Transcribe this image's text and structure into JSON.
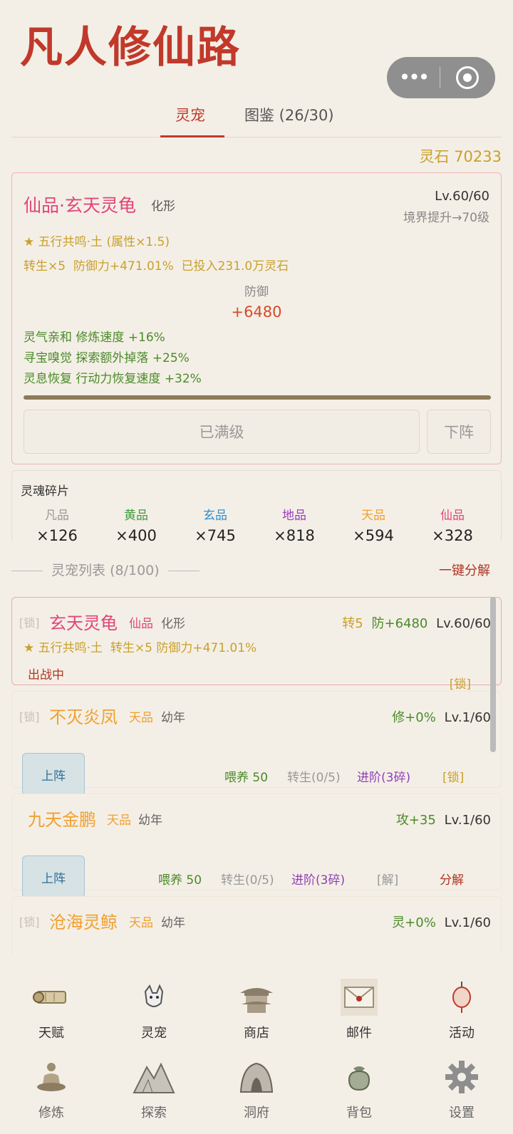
{
  "app": {
    "title": "凡人修仙路"
  },
  "capsule": {
    "more_glyph": "•••"
  },
  "tabs": [
    {
      "label": "灵宠"
    },
    {
      "label": "图鉴 (26/30)"
    }
  ],
  "stones": {
    "label": "灵石 70233"
  },
  "current_pet": {
    "name": "仙品·玄天灵龟",
    "form": "化形",
    "level": "Lv.60/60",
    "realm": "境界提升→70级",
    "resonance": "★ 五行共鸣·土 (属性×1.5)",
    "stats": "转生×5  防御力+471.01%  已投入231.0万灵石",
    "def_label": "防御",
    "def_value": "+6480",
    "buffs": [
      "灵气亲和 修炼速度 +16%",
      "寻宝嗅觉 探索额外掉落 +25%",
      "灵息恢复 行动力恢复速度 +32%"
    ],
    "progress": 1.0,
    "maxed_label": "已满级",
    "unequip_label": "下阵"
  },
  "fragments": {
    "title": "灵魂碎片",
    "items": [
      {
        "grade": "凡品",
        "count": "×126",
        "color": "#999999"
      },
      {
        "grade": "黄品",
        "count": "×400",
        "color": "#3c9a3c"
      },
      {
        "grade": "玄品",
        "count": "×745",
        "color": "#2f8fd6"
      },
      {
        "grade": "地品",
        "count": "×818",
        "color": "#9b3bc4"
      },
      {
        "grade": "天品",
        "count": "×594",
        "color": "#f0a030"
      },
      {
        "grade": "仙品",
        "count": "×328",
        "color": "#e2457a"
      }
    ]
  },
  "list": {
    "header": "灵宠列表 (8/100)",
    "decompose_all": "一键分解",
    "pets": [
      {
        "lock": "[锁]",
        "name": "玄天灵龟",
        "grade": "仙品",
        "age": "化形",
        "rebirth": "转5",
        "stat": "防+6480",
        "level": "Lv.60/60",
        "sub": "★ 五行共鸣·土  转生×5 防御力+471.01%",
        "status": "出战中",
        "lock_right": "[锁]"
      },
      {
        "lock": "[锁]",
        "name": "不灭炎凤",
        "grade": "天品",
        "age": "幼年",
        "stat": "修+0%",
        "level": "Lv.1/60",
        "up": "上阵",
        "feed": "喂养 50",
        "rebirth_act": "转生(0/5)",
        "advance": "进阶(3碎)",
        "lock_right": "[锁]"
      },
      {
        "name": "九天金鹏",
        "grade": "天品",
        "age": "幼年",
        "stat": "攻+35",
        "level": "Lv.1/60",
        "up": "上阵",
        "feed": "喂养 50",
        "rebirth_act": "转生(0/5)",
        "advance": "进阶(3碎)",
        "unlock": "[解]",
        "decompose": "分解"
      },
      {
        "lock": "[锁]",
        "name": "沧海灵鲸",
        "grade": "天品",
        "age": "幼年",
        "stat": "灵+0%",
        "level": "Lv.1/60"
      }
    ]
  },
  "nav": {
    "row1": [
      {
        "label": "天赋",
        "icon": "scroll-icon"
      },
      {
        "label": "灵宠",
        "icon": "fox-icon"
      },
      {
        "label": "商店",
        "icon": "pavilion-icon"
      },
      {
        "label": "邮件",
        "icon": "envelope-icon"
      },
      {
        "label": "活动",
        "icon": "lantern-icon"
      }
    ],
    "row2": [
      {
        "label": "修炼",
        "icon": "meditation-icon"
      },
      {
        "label": "探索",
        "icon": "mountain-icon"
      },
      {
        "label": "洞府",
        "icon": "cave-icon"
      },
      {
        "label": "背包",
        "icon": "bag-icon"
      },
      {
        "label": "设置",
        "icon": "gear-icon"
      }
    ]
  },
  "colors": {
    "accent": "#c0392b",
    "gold": "#c9a02c",
    "immortal": "#e2457a",
    "heaven": "#f0a030",
    "green": "#4a8a2a",
    "purple": "#8e3fb5"
  }
}
